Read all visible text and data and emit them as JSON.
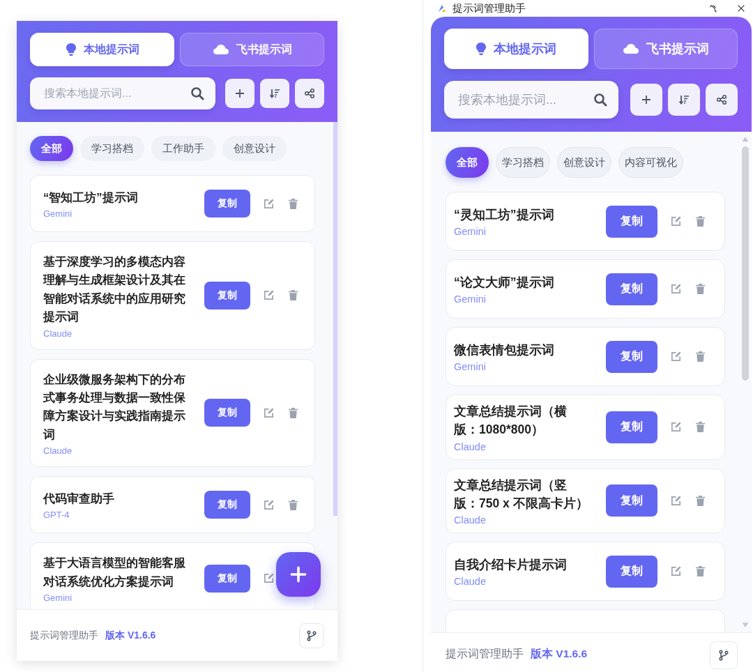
{
  "panels": [
    {
      "kind": "docked",
      "fab": true,
      "tabs": [
        {
          "label": "本地提示词",
          "selected": true
        },
        {
          "label": "飞书提示词",
          "selected": false
        }
      ],
      "search": {
        "placeholder": "搜索本地提示词..."
      },
      "categories": [
        {
          "label": "全部",
          "selected": true
        },
        {
          "label": "学习搭档",
          "selected": false
        },
        {
          "label": "工作助手",
          "selected": false
        },
        {
          "label": "创意设计",
          "selected": false
        }
      ],
      "prompts": [
        {
          "title": "“智知工坊”提示词",
          "model": "Gemini",
          "copy": "复制"
        },
        {
          "title": "基于深度学习的多模态内容理解与生成框架设计及其在智能对话系统中的应用研究提示词",
          "model": "Claude",
          "copy": "复制"
        },
        {
          "title": "企业级微服务架构下的分布式事务处理与数据一致性保障方案设计与实践指南提示词",
          "model": "Claude",
          "copy": "复制"
        },
        {
          "title": "代码审查助手",
          "model": "GPT-4",
          "copy": "复制"
        },
        {
          "title": "基于大语言模型的智能客服对话系统优化方案提示词",
          "model": "Gemini",
          "copy": "复制"
        }
      ],
      "footer": {
        "app_name": "提示词管理助手",
        "version": "版本 V1.6.6"
      }
    },
    {
      "kind": "window",
      "fab": false,
      "window": {
        "title": "提示词管理助手"
      },
      "tabs": [
        {
          "label": "本地提示词",
          "selected": true
        },
        {
          "label": "飞书提示词",
          "selected": false
        }
      ],
      "search": {
        "placeholder": "搜索本地提示词..."
      },
      "categories": [
        {
          "label": "全部",
          "selected": true
        },
        {
          "label": "学习搭档",
          "selected": false
        },
        {
          "label": "创意设计",
          "selected": false
        },
        {
          "label": "内容可视化",
          "selected": false
        }
      ],
      "prompts": [
        {
          "title": "“灵知工坊”提示词",
          "model": "Gemini",
          "copy": "复制"
        },
        {
          "title": "“论文大师”提示词",
          "model": "Gemini",
          "copy": "复制"
        },
        {
          "title": "微信表情包提示词",
          "model": "Gemini",
          "copy": "复制"
        },
        {
          "title": "文章总结提示词（横版：1080*800）",
          "model": "Claude",
          "copy": "复制"
        },
        {
          "title": "文章总结提示词（竖版：750 x 不限高卡片）",
          "model": "Claude",
          "copy": "复制"
        },
        {
          "title": "自我介绍卡片提示词",
          "model": "Claude",
          "copy": "复制"
        }
      ],
      "footer": {
        "app_name": "提示词管理助手",
        "version": "版本 V1.6.6"
      }
    }
  ]
}
